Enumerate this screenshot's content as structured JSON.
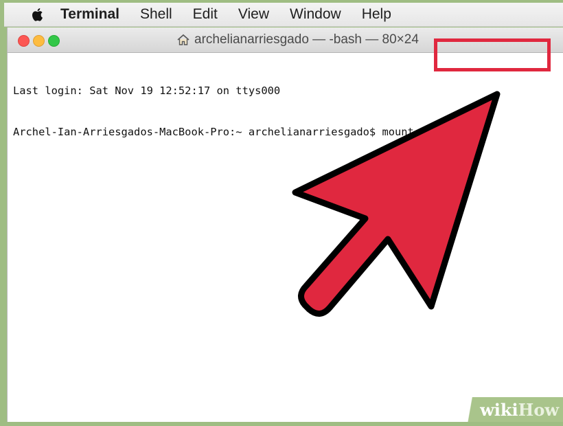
{
  "menubar": {
    "apple_icon": "apple-logo-icon",
    "app_name": "Terminal",
    "items": [
      "Shell",
      "Edit",
      "View",
      "Window",
      "Help"
    ]
  },
  "window": {
    "title": "archelianarriesgado — -bash — 80×24",
    "title_icon": "home-icon",
    "traffic_lights": {
      "close_color": "#fc5753",
      "minimize_color": "#fdbc40",
      "zoom_color": "#33c748"
    }
  },
  "terminal": {
    "line1": "Last login: Sat Nov 19 12:52:17 on ttys000",
    "prompt": "Archel-Ian-Arriesgados-MacBook-Pro:~ archelianarriesgado$ ",
    "command": "mount -uw /"
  },
  "annotation": {
    "highlight_color": "#e0283f",
    "arrow_fill": "#e0283f",
    "arrow_outline": "#000000"
  },
  "watermark": {
    "wiki": "wiki",
    "how": "How"
  }
}
